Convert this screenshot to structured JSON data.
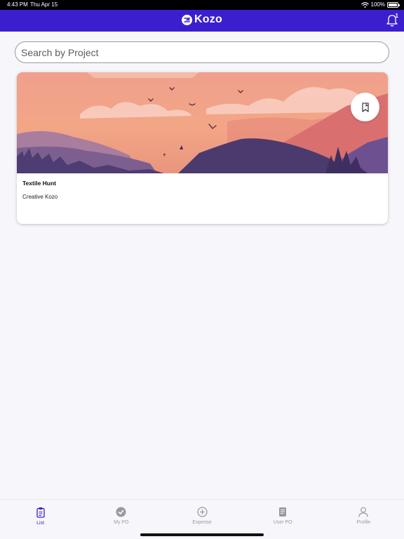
{
  "status_bar": {
    "time": "4:43 PM",
    "date": "Thu Apr 15",
    "battery": "100%"
  },
  "header": {
    "logo_text": "Kozo",
    "notification_count": "1"
  },
  "search": {
    "placeholder": "Search by Project",
    "value": ""
  },
  "projects": [
    {
      "title": "Textile Hunt",
      "subtitle": "Creative Kozo",
      "image_icon": "landscape-illustration",
      "action_icon": "bookmark-icon"
    }
  ],
  "tabs": [
    {
      "label": "List",
      "icon": "clipboard-list-icon",
      "active": true
    },
    {
      "label": "My PO",
      "icon": "check-circle-icon",
      "active": false
    },
    {
      "label": "Expense",
      "icon": "plus-circle-icon",
      "active": false
    },
    {
      "label": "User PO",
      "icon": "document-icon",
      "active": false
    },
    {
      "label": "Profile",
      "icon": "person-icon",
      "active": false
    }
  ],
  "colors": {
    "brand": "#3b1fcf",
    "background": "#f7f6fa",
    "tab_inactive": "#9a9aa2"
  }
}
